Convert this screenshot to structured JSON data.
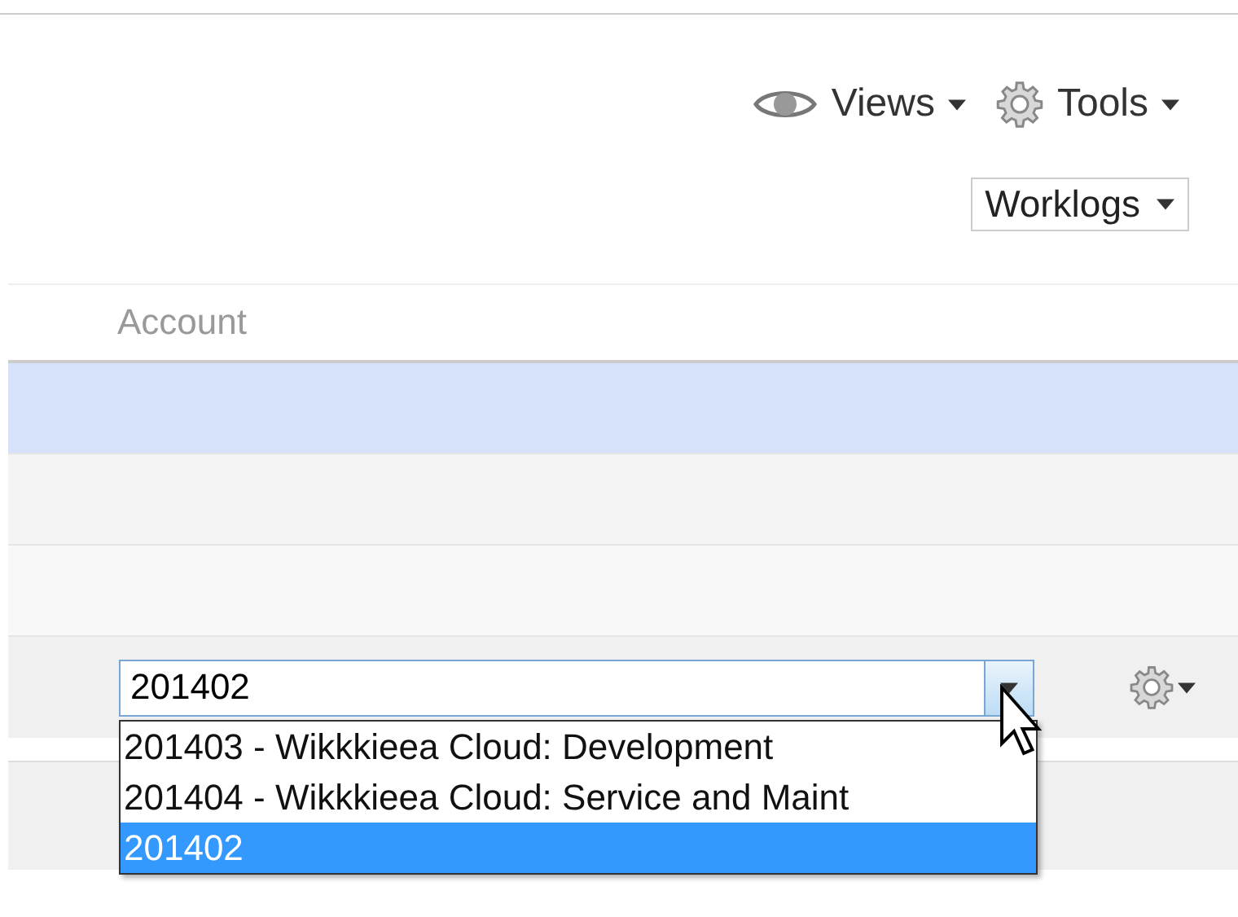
{
  "toolbar": [
    {
      "label": "Views",
      "kind": "eye"
    },
    {
      "label": "Tools",
      "kind": "gear"
    }
  ],
  "view_select": {
    "value": "Worklogs"
  },
  "table": {
    "columns": [
      "Account"
    ],
    "rows": [
      {
        "selected": true
      },
      {
        "selected": false
      },
      {
        "selected": false
      }
    ],
    "edit_row": {
      "account": {
        "value": "201402",
        "expanded": true,
        "options": [
          {
            "label": "201403 - Wikkkieea Cloud: Development",
            "selected": false
          },
          {
            "label": "201404 - Wikkkieea Cloud: Service and Maint",
            "selected": false
          },
          {
            "label": "201402",
            "selected": true
          }
        ]
      }
    }
  }
}
